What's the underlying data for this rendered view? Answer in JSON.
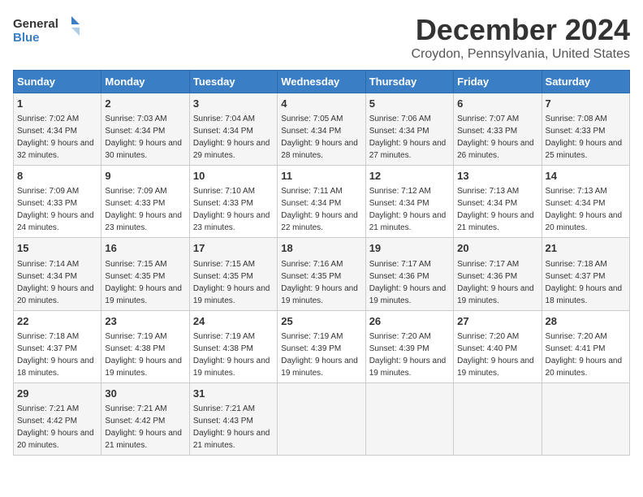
{
  "header": {
    "logo_general": "General",
    "logo_blue": "Blue",
    "month_title": "December 2024",
    "location": "Croydon, Pennsylvania, United States"
  },
  "days_of_week": [
    "Sunday",
    "Monday",
    "Tuesday",
    "Wednesday",
    "Thursday",
    "Friday",
    "Saturday"
  ],
  "weeks": [
    [
      {
        "day": "1",
        "sunrise": "7:02 AM",
        "sunset": "4:34 PM",
        "daylight": "9 hours and 32 minutes."
      },
      {
        "day": "2",
        "sunrise": "7:03 AM",
        "sunset": "4:34 PM",
        "daylight": "9 hours and 30 minutes."
      },
      {
        "day": "3",
        "sunrise": "7:04 AM",
        "sunset": "4:34 PM",
        "daylight": "9 hours and 29 minutes."
      },
      {
        "day": "4",
        "sunrise": "7:05 AM",
        "sunset": "4:34 PM",
        "daylight": "9 hours and 28 minutes."
      },
      {
        "day": "5",
        "sunrise": "7:06 AM",
        "sunset": "4:34 PM",
        "daylight": "9 hours and 27 minutes."
      },
      {
        "day": "6",
        "sunrise": "7:07 AM",
        "sunset": "4:33 PM",
        "daylight": "9 hours and 26 minutes."
      },
      {
        "day": "7",
        "sunrise": "7:08 AM",
        "sunset": "4:33 PM",
        "daylight": "9 hours and 25 minutes."
      }
    ],
    [
      {
        "day": "8",
        "sunrise": "7:09 AM",
        "sunset": "4:33 PM",
        "daylight": "9 hours and 24 minutes."
      },
      {
        "day": "9",
        "sunrise": "7:09 AM",
        "sunset": "4:33 PM",
        "daylight": "9 hours and 23 minutes."
      },
      {
        "day": "10",
        "sunrise": "7:10 AM",
        "sunset": "4:33 PM",
        "daylight": "9 hours and 23 minutes."
      },
      {
        "day": "11",
        "sunrise": "7:11 AM",
        "sunset": "4:34 PM",
        "daylight": "9 hours and 22 minutes."
      },
      {
        "day": "12",
        "sunrise": "7:12 AM",
        "sunset": "4:34 PM",
        "daylight": "9 hours and 21 minutes."
      },
      {
        "day": "13",
        "sunrise": "7:13 AM",
        "sunset": "4:34 PM",
        "daylight": "9 hours and 21 minutes."
      },
      {
        "day": "14",
        "sunrise": "7:13 AM",
        "sunset": "4:34 PM",
        "daylight": "9 hours and 20 minutes."
      }
    ],
    [
      {
        "day": "15",
        "sunrise": "7:14 AM",
        "sunset": "4:34 PM",
        "daylight": "9 hours and 20 minutes."
      },
      {
        "day": "16",
        "sunrise": "7:15 AM",
        "sunset": "4:35 PM",
        "daylight": "9 hours and 19 minutes."
      },
      {
        "day": "17",
        "sunrise": "7:15 AM",
        "sunset": "4:35 PM",
        "daylight": "9 hours and 19 minutes."
      },
      {
        "day": "18",
        "sunrise": "7:16 AM",
        "sunset": "4:35 PM",
        "daylight": "9 hours and 19 minutes."
      },
      {
        "day": "19",
        "sunrise": "7:17 AM",
        "sunset": "4:36 PM",
        "daylight": "9 hours and 19 minutes."
      },
      {
        "day": "20",
        "sunrise": "7:17 AM",
        "sunset": "4:36 PM",
        "daylight": "9 hours and 19 minutes."
      },
      {
        "day": "21",
        "sunrise": "7:18 AM",
        "sunset": "4:37 PM",
        "daylight": "9 hours and 18 minutes."
      }
    ],
    [
      {
        "day": "22",
        "sunrise": "7:18 AM",
        "sunset": "4:37 PM",
        "daylight": "9 hours and 18 minutes."
      },
      {
        "day": "23",
        "sunrise": "7:19 AM",
        "sunset": "4:38 PM",
        "daylight": "9 hours and 19 minutes."
      },
      {
        "day": "24",
        "sunrise": "7:19 AM",
        "sunset": "4:38 PM",
        "daylight": "9 hours and 19 minutes."
      },
      {
        "day": "25",
        "sunrise": "7:19 AM",
        "sunset": "4:39 PM",
        "daylight": "9 hours and 19 minutes."
      },
      {
        "day": "26",
        "sunrise": "7:20 AM",
        "sunset": "4:39 PM",
        "daylight": "9 hours and 19 minutes."
      },
      {
        "day": "27",
        "sunrise": "7:20 AM",
        "sunset": "4:40 PM",
        "daylight": "9 hours and 19 minutes."
      },
      {
        "day": "28",
        "sunrise": "7:20 AM",
        "sunset": "4:41 PM",
        "daylight": "9 hours and 20 minutes."
      }
    ],
    [
      {
        "day": "29",
        "sunrise": "7:21 AM",
        "sunset": "4:42 PM",
        "daylight": "9 hours and 20 minutes."
      },
      {
        "day": "30",
        "sunrise": "7:21 AM",
        "sunset": "4:42 PM",
        "daylight": "9 hours and 21 minutes."
      },
      {
        "day": "31",
        "sunrise": "7:21 AM",
        "sunset": "4:43 PM",
        "daylight": "9 hours and 21 minutes."
      },
      null,
      null,
      null,
      null
    ]
  ],
  "labels": {
    "sunrise": "Sunrise:",
    "sunset": "Sunset:",
    "daylight": "Daylight:"
  }
}
